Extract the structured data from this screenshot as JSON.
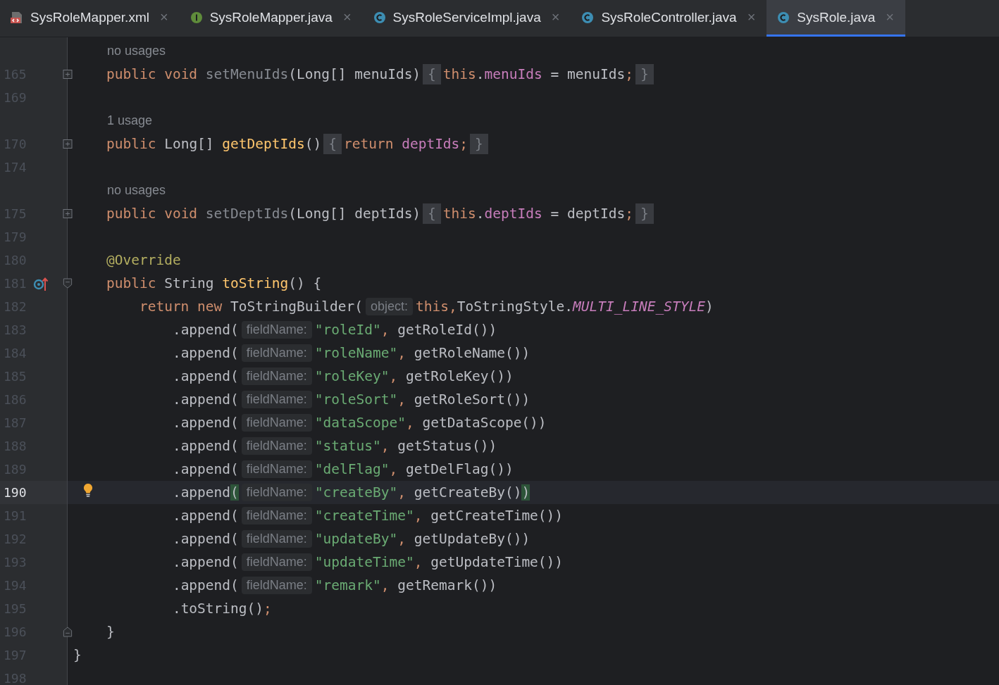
{
  "tabs": [
    {
      "label": "SysRoleMapper.xml",
      "kind": "xml",
      "close": "×",
      "selected": false
    },
    {
      "label": "SysRoleMapper.java",
      "kind": "interface",
      "close": "×",
      "selected": false
    },
    {
      "label": "SysRoleServiceImpl.java",
      "kind": "class",
      "close": "×",
      "selected": false
    },
    {
      "label": "SysRoleController.java",
      "kind": "class",
      "close": "×",
      "selected": false
    },
    {
      "label": "SysRole.java",
      "kind": "class",
      "close": "×",
      "selected": true
    }
  ],
  "editor": {
    "rows": [
      {
        "kind": "usage",
        "text": "no usages"
      },
      {
        "kind": "code",
        "number": "165",
        "current": false,
        "gutter": [
          {
            "kind": "expand"
          }
        ],
        "tokens": [
          {
            "kind": "keyword",
            "text": "    public void "
          },
          {
            "kind": "unused",
            "text": "setMenuIds"
          },
          {
            "kind": "plain",
            "text": "(Long[] menuIds)"
          },
          {
            "kind": "fold",
            "text": "{"
          },
          {
            "kind": "keyword",
            "text": "this"
          },
          {
            "kind": "plain",
            "text": "."
          },
          {
            "kind": "field",
            "text": "menuIds"
          },
          {
            "kind": "plain",
            "text": " = menuIds"
          },
          {
            "kind": "punct",
            "text": ";"
          },
          {
            "kind": "fold",
            "text": "}"
          }
        ]
      },
      {
        "kind": "code",
        "number": "169",
        "current": false
      },
      {
        "kind": "usage",
        "text": "1 usage"
      },
      {
        "kind": "code",
        "number": "170",
        "current": false,
        "gutter": [
          {
            "kind": "expand"
          }
        ],
        "tokens": [
          {
            "kind": "keyword",
            "text": "    public "
          },
          {
            "kind": "plain",
            "text": "Long[] "
          },
          {
            "kind": "method",
            "text": "getDeptIds"
          },
          {
            "kind": "plain",
            "text": "()"
          },
          {
            "kind": "fold",
            "text": "{"
          },
          {
            "kind": "keyword",
            "text": "return "
          },
          {
            "kind": "field",
            "text": "deptIds"
          },
          {
            "kind": "punct",
            "text": ";"
          },
          {
            "kind": "fold",
            "text": "}"
          }
        ]
      },
      {
        "kind": "code",
        "number": "174",
        "current": false
      },
      {
        "kind": "usage",
        "text": "no usages"
      },
      {
        "kind": "code",
        "number": "175",
        "current": false,
        "gutter": [
          {
            "kind": "expand"
          }
        ],
        "tokens": [
          {
            "kind": "keyword",
            "text": "    public void "
          },
          {
            "kind": "unused",
            "text": "setDeptIds"
          },
          {
            "kind": "plain",
            "text": "(Long[] deptIds)"
          },
          {
            "kind": "fold",
            "text": "{"
          },
          {
            "kind": "keyword",
            "text": "this"
          },
          {
            "kind": "plain",
            "text": "."
          },
          {
            "kind": "field",
            "text": "deptIds"
          },
          {
            "kind": "plain",
            "text": " = deptIds"
          },
          {
            "kind": "punct",
            "text": ";"
          },
          {
            "kind": "fold",
            "text": "}"
          }
        ]
      },
      {
        "kind": "code",
        "number": "179",
        "current": false
      },
      {
        "kind": "code",
        "number": "180",
        "current": false,
        "tokens": [
          {
            "kind": "annotation",
            "text": "    @Override"
          }
        ]
      },
      {
        "kind": "code",
        "number": "181",
        "current": false,
        "gutter": [
          {
            "kind": "override"
          },
          {
            "kind": "collapse"
          }
        ],
        "tokens": [
          {
            "kind": "keyword",
            "text": "    public "
          },
          {
            "kind": "plain",
            "text": "String "
          },
          {
            "kind": "method",
            "text": "toString"
          },
          {
            "kind": "plain",
            "text": "() {"
          }
        ]
      },
      {
        "kind": "code",
        "number": "182",
        "current": false,
        "tokens": [
          {
            "kind": "keyword",
            "text": "        return new "
          },
          {
            "kind": "plain",
            "text": "ToStringBuilder("
          },
          {
            "kind": "hint",
            "text": "object:"
          },
          {
            "kind": "keyword",
            "text": "this,"
          },
          {
            "kind": "plain",
            "text": "ToStringStyle."
          },
          {
            "kind": "static",
            "text": "MULTI_LINE_STYLE"
          },
          {
            "kind": "plain",
            "text": ")"
          }
        ]
      },
      {
        "kind": "code",
        "number": "183",
        "current": false,
        "tokens": [
          {
            "kind": "plain",
            "text": "            .append("
          },
          {
            "kind": "hint",
            "text": "fieldName:"
          },
          {
            "kind": "string",
            "text": "\"roleId\""
          },
          {
            "kind": "punct",
            "text": ","
          },
          {
            "kind": "plain",
            "text": " getRoleId())"
          }
        ]
      },
      {
        "kind": "code",
        "number": "184",
        "current": false,
        "tokens": [
          {
            "kind": "plain",
            "text": "            .append("
          },
          {
            "kind": "hint",
            "text": "fieldName:"
          },
          {
            "kind": "string",
            "text": "\"roleName\""
          },
          {
            "kind": "punct",
            "text": ","
          },
          {
            "kind": "plain",
            "text": " getRoleName())"
          }
        ]
      },
      {
        "kind": "code",
        "number": "185",
        "current": false,
        "tokens": [
          {
            "kind": "plain",
            "text": "            .append("
          },
          {
            "kind": "hint",
            "text": "fieldName:"
          },
          {
            "kind": "string",
            "text": "\"roleKey\""
          },
          {
            "kind": "punct",
            "text": ","
          },
          {
            "kind": "plain",
            "text": " getRoleKey())"
          }
        ]
      },
      {
        "kind": "code",
        "number": "186",
        "current": false,
        "tokens": [
          {
            "kind": "plain",
            "text": "            .append("
          },
          {
            "kind": "hint",
            "text": "fieldName:"
          },
          {
            "kind": "string",
            "text": "\"roleSort\""
          },
          {
            "kind": "punct",
            "text": ","
          },
          {
            "kind": "plain",
            "text": " getRoleSort())"
          }
        ]
      },
      {
        "kind": "code",
        "number": "187",
        "current": false,
        "tokens": [
          {
            "kind": "plain",
            "text": "            .append("
          },
          {
            "kind": "hint",
            "text": "fieldName:"
          },
          {
            "kind": "string",
            "text": "\"dataScope\""
          },
          {
            "kind": "punct",
            "text": ","
          },
          {
            "kind": "plain",
            "text": " getDataScope())"
          }
        ]
      },
      {
        "kind": "code",
        "number": "188",
        "current": false,
        "tokens": [
          {
            "kind": "plain",
            "text": "            .append("
          },
          {
            "kind": "hint",
            "text": "fieldName:"
          },
          {
            "kind": "string",
            "text": "\"status\""
          },
          {
            "kind": "punct",
            "text": ","
          },
          {
            "kind": "plain",
            "text": " getStatus())"
          }
        ]
      },
      {
        "kind": "code",
        "number": "189",
        "current": false,
        "tokens": [
          {
            "kind": "plain",
            "text": "            .append("
          },
          {
            "kind": "hint",
            "text": "fieldName:"
          },
          {
            "kind": "string",
            "text": "\"delFlag\""
          },
          {
            "kind": "punct",
            "text": ","
          },
          {
            "kind": "plain",
            "text": " getDelFlag())"
          }
        ]
      },
      {
        "kind": "code",
        "number": "190",
        "current": true,
        "gutter": [
          {
            "kind": "bulb"
          }
        ],
        "tokens": [
          {
            "kind": "plain",
            "text": "            .append"
          },
          {
            "kind": "match",
            "text": "("
          },
          {
            "kind": "hint",
            "text": "fieldName:"
          },
          {
            "kind": "string",
            "text": "\"createBy\""
          },
          {
            "kind": "punct",
            "text": ","
          },
          {
            "kind": "plain",
            "text": " getCreateBy()"
          },
          {
            "kind": "match",
            "text": ")"
          }
        ]
      },
      {
        "kind": "code",
        "number": "191",
        "current": false,
        "tokens": [
          {
            "kind": "plain",
            "text": "            .append("
          },
          {
            "kind": "hint",
            "text": "fieldName:"
          },
          {
            "kind": "string",
            "text": "\"createTime\""
          },
          {
            "kind": "punct",
            "text": ","
          },
          {
            "kind": "plain",
            "text": " getCreateTime())"
          }
        ]
      },
      {
        "kind": "code",
        "number": "192",
        "current": false,
        "tokens": [
          {
            "kind": "plain",
            "text": "            .append("
          },
          {
            "kind": "hint",
            "text": "fieldName:"
          },
          {
            "kind": "string",
            "text": "\"updateBy\""
          },
          {
            "kind": "punct",
            "text": ","
          },
          {
            "kind": "plain",
            "text": " getUpdateBy())"
          }
        ]
      },
      {
        "kind": "code",
        "number": "193",
        "current": false,
        "tokens": [
          {
            "kind": "plain",
            "text": "            .append("
          },
          {
            "kind": "hint",
            "text": "fieldName:"
          },
          {
            "kind": "string",
            "text": "\"updateTime\""
          },
          {
            "kind": "punct",
            "text": ","
          },
          {
            "kind": "plain",
            "text": " getUpdateTime())"
          }
        ]
      },
      {
        "kind": "code",
        "number": "194",
        "current": false,
        "tokens": [
          {
            "kind": "plain",
            "text": "            .append("
          },
          {
            "kind": "hint",
            "text": "fieldName:"
          },
          {
            "kind": "string",
            "text": "\"remark\""
          },
          {
            "kind": "punct",
            "text": ","
          },
          {
            "kind": "plain",
            "text": " getRemark())"
          }
        ]
      },
      {
        "kind": "code",
        "number": "195",
        "current": false,
        "tokens": [
          {
            "kind": "plain",
            "text": "            .toString()"
          },
          {
            "kind": "punct",
            "text": ";"
          }
        ]
      },
      {
        "kind": "code",
        "number": "196",
        "current": false,
        "gutter": [
          {
            "kind": "end"
          }
        ],
        "tokens": [
          {
            "kind": "plain",
            "text": "    }"
          }
        ]
      },
      {
        "kind": "code",
        "number": "197",
        "current": false,
        "tokens": [
          {
            "kind": "plain",
            "text": "}"
          }
        ]
      },
      {
        "kind": "code",
        "number": "198",
        "current": false
      }
    ]
  }
}
